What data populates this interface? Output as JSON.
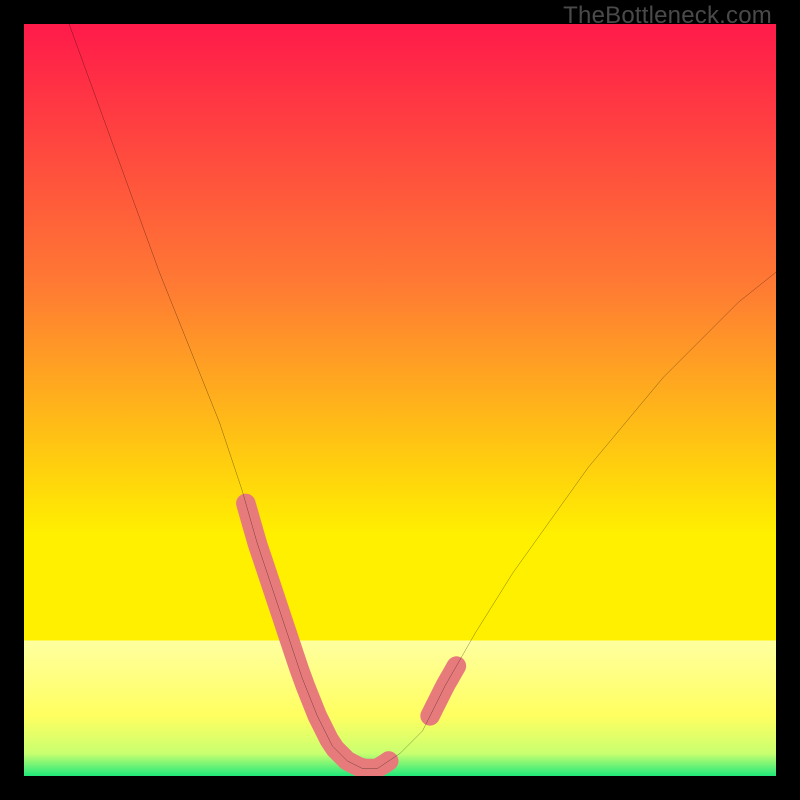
{
  "watermark": "TheBottleneck.com",
  "colors": {
    "bg_top": "#ff1a4a",
    "bg_mid1": "#ff7b33",
    "bg_mid2": "#fff000",
    "bg_band": "#ffffa0",
    "bg_bottom": "#20e87a",
    "frame": "#000000",
    "curve": "#000000",
    "highlight": "#e77b7b"
  },
  "chart_data": {
    "type": "line",
    "title": "",
    "xlabel": "",
    "ylabel": "",
    "xlim": [
      0,
      100
    ],
    "ylim": [
      0,
      100
    ],
    "series": [
      {
        "name": "curve",
        "x": [
          6,
          10,
          14,
          18,
          22,
          26,
          29,
          31,
          33,
          35,
          37,
          39,
          41,
          43,
          45,
          47,
          50,
          53,
          56,
          60,
          65,
          70,
          75,
          80,
          85,
          90,
          95,
          100
        ],
        "values": [
          100,
          89,
          78,
          67,
          57,
          47,
          38,
          31,
          25,
          19,
          13,
          8,
          4,
          2,
          1,
          1,
          3,
          6,
          12,
          19,
          27,
          34,
          41,
          47,
          53,
          58,
          63,
          67
        ]
      }
    ],
    "highlight_x_ranges": [
      [
        29.5,
        48.5
      ],
      [
        54.0,
        57.5
      ]
    ],
    "highlight_y_max": 14
  }
}
